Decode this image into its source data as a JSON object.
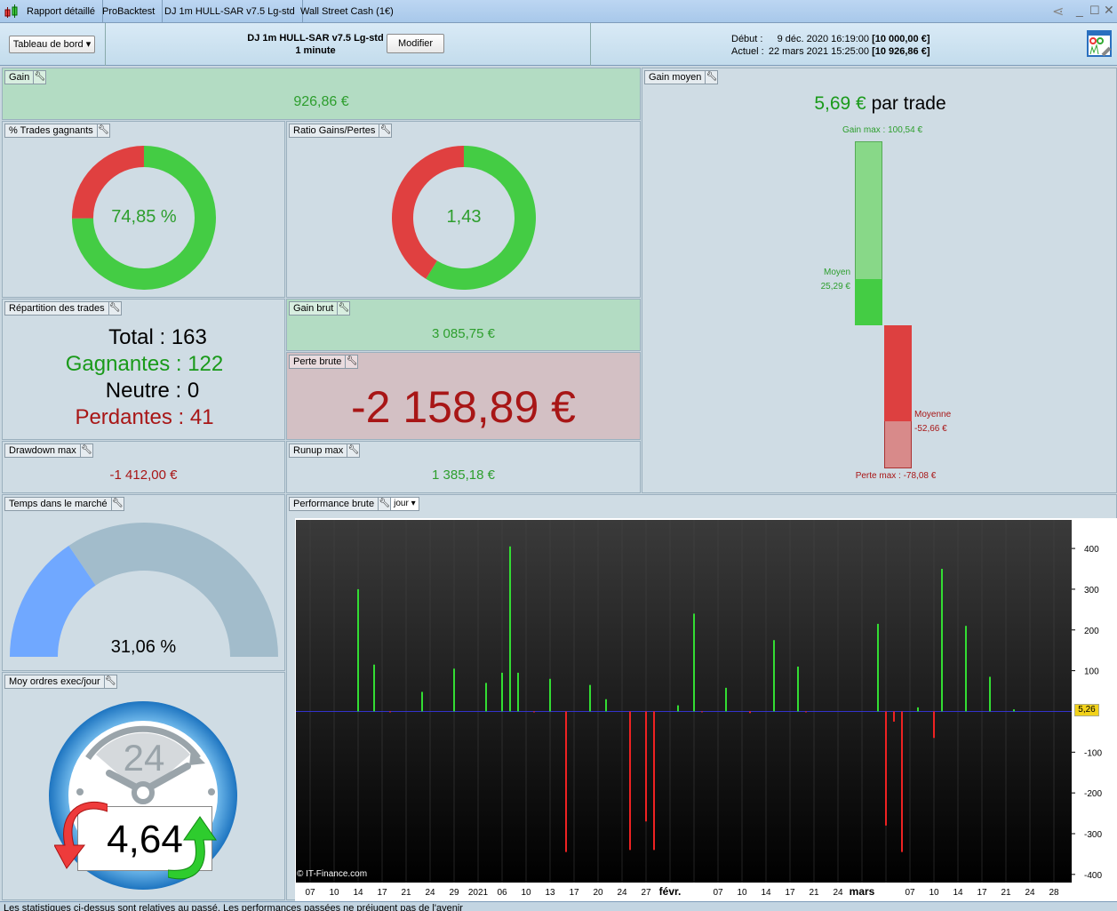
{
  "window": {
    "tabs": [
      "Rapport détaillé",
      "ProBacktest",
      "DJ 1m HULL-SAR v7.5 Lg-std",
      "Wall Street Cash (1€)"
    ]
  },
  "header": {
    "view_select": "Tableau de bord",
    "strategy": "DJ 1m HULL-SAR v7.5 Lg-std",
    "timeframe": "1 minute",
    "modify": "Modifier",
    "start_label": "Début :",
    "start_date": "9 déc. 2020 16:19:00",
    "start_capital": "[10 000,00 €]",
    "current_label": "Actuel :",
    "current_date": "22 mars 2021 15:25:00",
    "current_capital": "[10 926,86 €]"
  },
  "panels": {
    "gain": {
      "label": "Gain",
      "value": "926,86 €"
    },
    "win_pct": {
      "label": "% Trades gagnants",
      "value": "74,85 %",
      "fraction": 0.7485
    },
    "ratio": {
      "label": "Ratio Gains/Pertes",
      "value": "1,43",
      "ratio": 1.43
    },
    "distribution": {
      "label": "Répartition des trades",
      "total": "Total : 163",
      "winners": "Gagnantes : 122",
      "neutral": "Neutre : 0",
      "losers": "Perdantes : 41"
    },
    "gross_gain": {
      "label": "Gain brut",
      "value": "3 085,75 €"
    },
    "gross_loss": {
      "label": "Perte brute",
      "value": "-2 158,89 €"
    },
    "drawdown": {
      "label": "Drawdown max",
      "value": "-1 412,00 €"
    },
    "runup": {
      "label": "Runup max",
      "value": "1 385,18 €"
    },
    "avg_gain": {
      "label": "Gain moyen",
      "value": "5,69 €",
      "suffix": "par trade",
      "max_gain_text": "Gain max : 100,54 €",
      "avg_win_label": "Moyen",
      "avg_win_text": "25,29 €",
      "avg_loss_label": "Moyenne",
      "avg_loss_text": "-52,66 €",
      "max_loss_text": "Perte max : -78,08 €",
      "max_gain": 100.54,
      "avg_win": 25.29,
      "avg_loss": -52.66,
      "max_loss": -78.08
    },
    "time_in_market": {
      "label": "Temps dans le marché",
      "value": "31,06 %",
      "fraction": 0.3106
    },
    "orders": {
      "label": "Moy ordres exec/jour",
      "value": "4,64",
      "clock_text": "24"
    },
    "performance": {
      "label": "Performance brute",
      "period": "jour",
      "copyright": "© IT-Finance.com",
      "last_value": "5,26"
    }
  },
  "chart_data": {
    "type": "bar",
    "ylim": [
      -420,
      470
    ],
    "yticks": [
      400,
      300,
      200,
      100,
      -100,
      -200,
      -300,
      -400
    ],
    "colors": {
      "positive": "#33dd33",
      "negative": "#ee2222",
      "zero_line": "#3333cc"
    },
    "xticks": [
      [
        "2020-12-07",
        "07"
      ],
      [
        "2020-12-10",
        "10"
      ],
      [
        "2020-12-14",
        "14"
      ],
      [
        "2020-12-17",
        "17"
      ],
      [
        "2020-12-21",
        "21"
      ],
      [
        "2020-12-24",
        "24"
      ],
      [
        "2020-12-29",
        "29"
      ],
      [
        "2021-01-03",
        "2021"
      ],
      [
        "2021-01-06",
        "06"
      ],
      [
        "2021-01-10",
        "10"
      ],
      [
        "2021-01-13",
        "13"
      ],
      [
        "2021-01-17",
        "17"
      ],
      [
        "2021-01-20",
        "20"
      ],
      [
        "2021-01-24",
        "24"
      ],
      [
        "2021-01-27",
        "27"
      ],
      [
        "2021-01-31",
        "févr."
      ],
      [
        "2021-02-07",
        "07"
      ],
      [
        "2021-02-10",
        "10"
      ],
      [
        "2021-02-14",
        "14"
      ],
      [
        "2021-02-17",
        "17"
      ],
      [
        "2021-02-21",
        "21"
      ],
      [
        "2021-02-24",
        "24"
      ],
      [
        "2021-02-28",
        "mars"
      ],
      [
        "2021-03-07",
        "07"
      ],
      [
        "2021-03-10",
        "10"
      ],
      [
        "2021-03-14",
        "14"
      ],
      [
        "2021-03-17",
        "17"
      ],
      [
        "2021-03-21",
        "21"
      ],
      [
        "2021-03-24",
        "24"
      ],
      [
        "2021-03-28",
        "28"
      ]
    ],
    "bars": [
      [
        "2020-12-14",
        300
      ],
      [
        "2020-12-16",
        115
      ],
      [
        "2020-12-18",
        -2
      ],
      [
        "2020-12-23",
        48
      ],
      [
        "2020-12-29",
        105
      ],
      [
        "2021-01-04",
        70
      ],
      [
        "2021-01-06",
        95
      ],
      [
        "2021-01-07",
        405
      ],
      [
        "2021-01-08",
        95
      ],
      [
        "2021-01-11",
        -2
      ],
      [
        "2021-01-13",
        80
      ],
      [
        "2021-01-15",
        -345
      ],
      [
        "2021-01-19",
        65
      ],
      [
        "2021-01-21",
        30
      ],
      [
        "2021-01-25",
        -340
      ],
      [
        "2021-01-27",
        -270
      ],
      [
        "2021-01-28",
        -340
      ],
      [
        "2021-02-01",
        15
      ],
      [
        "2021-02-03",
        240
      ],
      [
        "2021-02-04",
        -2
      ],
      [
        "2021-02-08",
        58
      ],
      [
        "2021-02-11",
        -4
      ],
      [
        "2021-02-15",
        175
      ],
      [
        "2021-02-18",
        110
      ],
      [
        "2021-02-19",
        -2
      ],
      [
        "2021-03-02",
        215
      ],
      [
        "2021-03-03",
        -280
      ],
      [
        "2021-03-04",
        -25
      ],
      [
        "2021-03-05",
        -345
      ],
      [
        "2021-03-08",
        10
      ],
      [
        "2021-03-10",
        -65
      ],
      [
        "2021-03-11",
        350
      ],
      [
        "2021-03-15",
        210
      ],
      [
        "2021-03-18",
        85
      ],
      [
        "2021-03-22",
        5
      ]
    ]
  },
  "footer": "Les statistiques ci-dessus sont relatives au passé. Les performances passées ne préjugent pas de l'avenir"
}
